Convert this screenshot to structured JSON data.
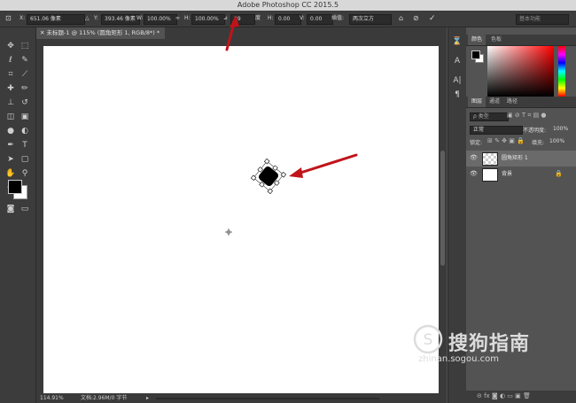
{
  "window": {
    "title": "Adobe Photoshop CC 2015.5"
  },
  "options": {
    "x_label": "X:",
    "x_value": "651.06 像素",
    "y_label": "Y:",
    "y_value": "393.46 像素",
    "w_label": "W:",
    "w_value": "100.00%",
    "h_label": "H:",
    "h_value": "100.00%",
    "angle_value": "39",
    "angle_unit": "度",
    "hskew_label": "H:",
    "hskew_value": "0.00",
    "vskew_label": "V:",
    "vskew_value": "0.00",
    "interp_label": "插值:",
    "interp_value": "两次立方",
    "workspace": "基本功能"
  },
  "document": {
    "tab_title": "未标题-1 @ 115% (圆角矩形 1, RGB/8*) *",
    "zoom": "114.91%",
    "doc_info": "文档:2.96M/0 字节"
  },
  "panels": {
    "color_tabs": [
      "颜色",
      "色板"
    ],
    "layer_tabs": [
      "图层",
      "通道",
      "路径"
    ],
    "search_placeholder": "ρ 类型",
    "blend_mode": "正常",
    "opacity_label": "不透明度:",
    "opacity_value": "100%",
    "lock_label": "锁定:",
    "fill_label": "填充:",
    "fill_value": "100%",
    "layers": [
      {
        "name": "圆角矩形 1",
        "selected": true
      },
      {
        "name": "背景",
        "selected": false
      }
    ]
  },
  "watermark": {
    "brand": "搜狗指南",
    "url": "zhinan.sogou.com"
  },
  "colors": {
    "arrow": "#c0141a",
    "canvas": "#ffffff",
    "panel": "#535353",
    "bar": "#3c3c3c"
  }
}
